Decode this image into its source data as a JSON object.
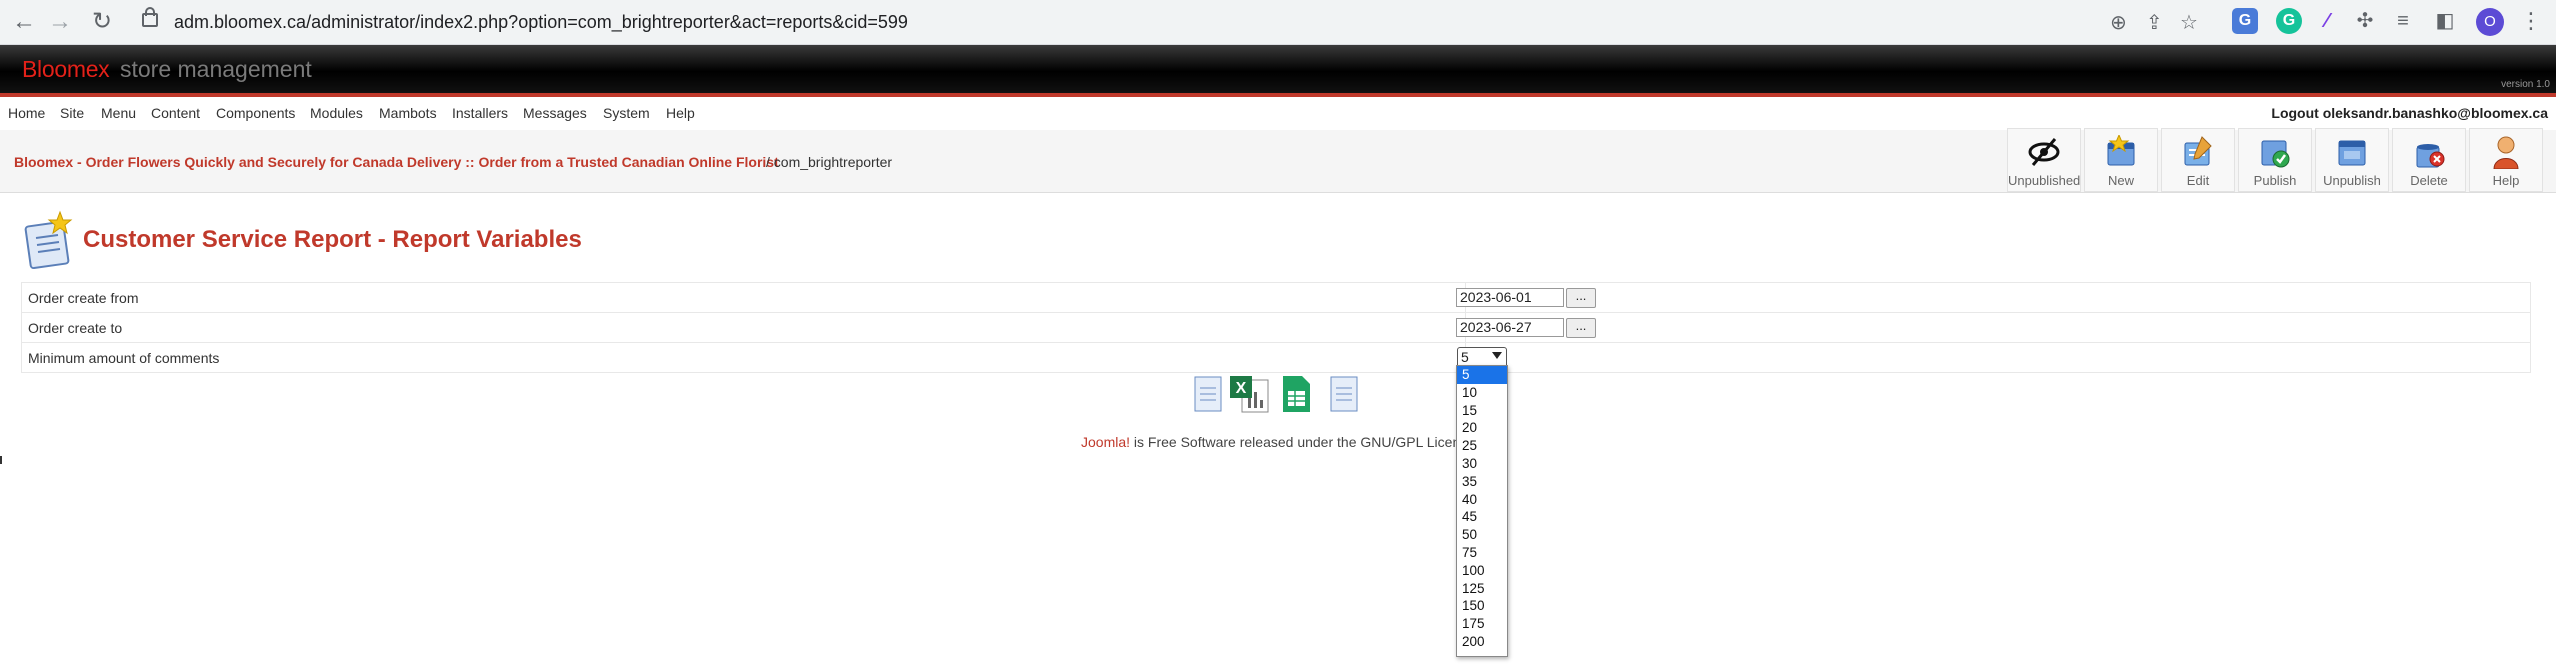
{
  "browser": {
    "url": "adm.bloomex.ca/administrator/index2.php?option=com_brightreporter&act=reports&cid=599",
    "profile_initial": "O"
  },
  "header": {
    "brand": "Bloomex",
    "brand_sub": "store management",
    "version": "version 1.0"
  },
  "menu": {
    "items": [
      "Home",
      "Site",
      "Menu",
      "Content",
      "Components",
      "Modules",
      "Mambots",
      "Installers",
      "Messages",
      "System",
      "Help"
    ],
    "logout": "Logout oleksandr.banashko@bloomex.ca"
  },
  "pathway": {
    "site_link": "Bloomex - Order Flowers Quickly and Securely for Canada Delivery :: Order from a Trusted Canadian Online Florist",
    "tail": "/ com_brightreporter"
  },
  "toolbar": {
    "buttons": [
      "Unpublished",
      "New",
      "Edit",
      "Publish",
      "Unpublish",
      "Delete",
      "Help"
    ]
  },
  "page": {
    "title": "Customer Service Report - Report Variables"
  },
  "form": {
    "rows": [
      {
        "label": "Order create from",
        "value": "2023-06-01",
        "button": "..."
      },
      {
        "label": "Order create to",
        "value": "2023-06-27",
        "button": "..."
      },
      {
        "label": "Minimum amount of comments"
      }
    ],
    "comments_select": {
      "selected": "5",
      "options": [
        "5",
        "10",
        "15",
        "20",
        "25",
        "30",
        "35",
        "40",
        "45",
        "50",
        "75",
        "100",
        "125",
        "150",
        "175",
        "200"
      ]
    }
  },
  "footer": {
    "joomla": "Joomla!",
    "text": " is Free Software released under the GNU/GPL License."
  }
}
